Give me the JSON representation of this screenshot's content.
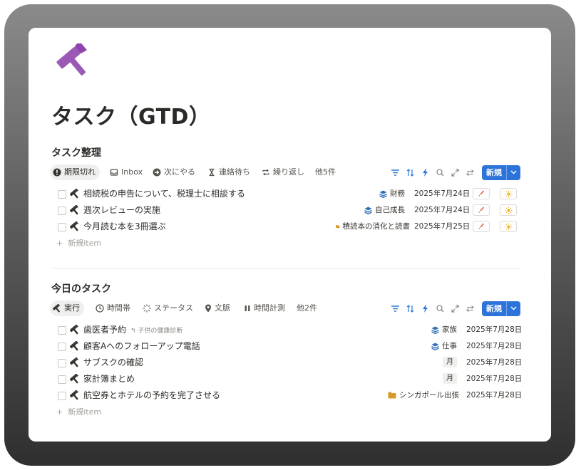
{
  "page": {
    "title": "タスク（GTD）"
  },
  "colors": {
    "accent": "#2d74da",
    "hammer": "#9b59b6",
    "folder": "#d99a2b",
    "stack": "#2f6fb5"
  },
  "sections": [
    {
      "title": "タスク整理",
      "tabs": [
        {
          "label": "期限切れ",
          "icon": "alert-circle-icon",
          "active": true
        },
        {
          "label": "Inbox",
          "icon": "inbox-icon"
        },
        {
          "label": "次にやる",
          "icon": "arrow-right-circle-icon"
        },
        {
          "label": "連絡待ち",
          "icon": "hourglass-icon"
        },
        {
          "label": "繰り返し",
          "icon": "repeat-icon"
        },
        {
          "label": "他5件"
        }
      ],
      "new_label": "新規",
      "rows": [
        {
          "name": "相続税の申告について、税理士に相談する",
          "tag": "財務",
          "tag_icon": "stack-icon",
          "date": "2025年7月24日"
        },
        {
          "name": "週次レビューの実施",
          "tag": "自己成長",
          "tag_icon": "stack-icon",
          "date": "2025年7月24日"
        },
        {
          "name": "今月読む本を3冊選ぶ",
          "tag": "積読本の消化と読書",
          "tag_icon": "folder-icon",
          "date": "2025年7月25日"
        }
      ],
      "new_item": "新規item"
    },
    {
      "title": "今日のタスク",
      "tabs": [
        {
          "label": "実行",
          "icon": "hammer-icon",
          "active": true
        },
        {
          "label": "時間帯",
          "icon": "clock-icon"
        },
        {
          "label": "ステータス",
          "icon": "loader-icon"
        },
        {
          "label": "文脈",
          "icon": "map-pin-icon"
        },
        {
          "label": "時間計測",
          "icon": "pause-icon"
        },
        {
          "label": "他2件"
        }
      ],
      "new_label": "新規",
      "rows": [
        {
          "name": "歯医者予約",
          "sub": "↰ 子供の健康診断",
          "tag": "家族",
          "tag_icon": "stack-icon",
          "date": "2025年7月28日"
        },
        {
          "name": "顧客Aへのフォローアップ電話",
          "tag": "仕事",
          "tag_icon": "stack-icon",
          "date": "2025年7月28日"
        },
        {
          "name": "サブスクの確認",
          "tag": "月",
          "tag_type": "month",
          "date": "2025年7月28日"
        },
        {
          "name": "家計簿まとめ",
          "tag": "月",
          "tag_type": "month",
          "date": "2025年7月28日"
        },
        {
          "name": "航空券とホテルの予約を完了させる",
          "tag": "シンガポール出張",
          "tag_icon": "folder-icon",
          "date": "2025年7月28日"
        }
      ],
      "new_item": "新規item"
    }
  ]
}
